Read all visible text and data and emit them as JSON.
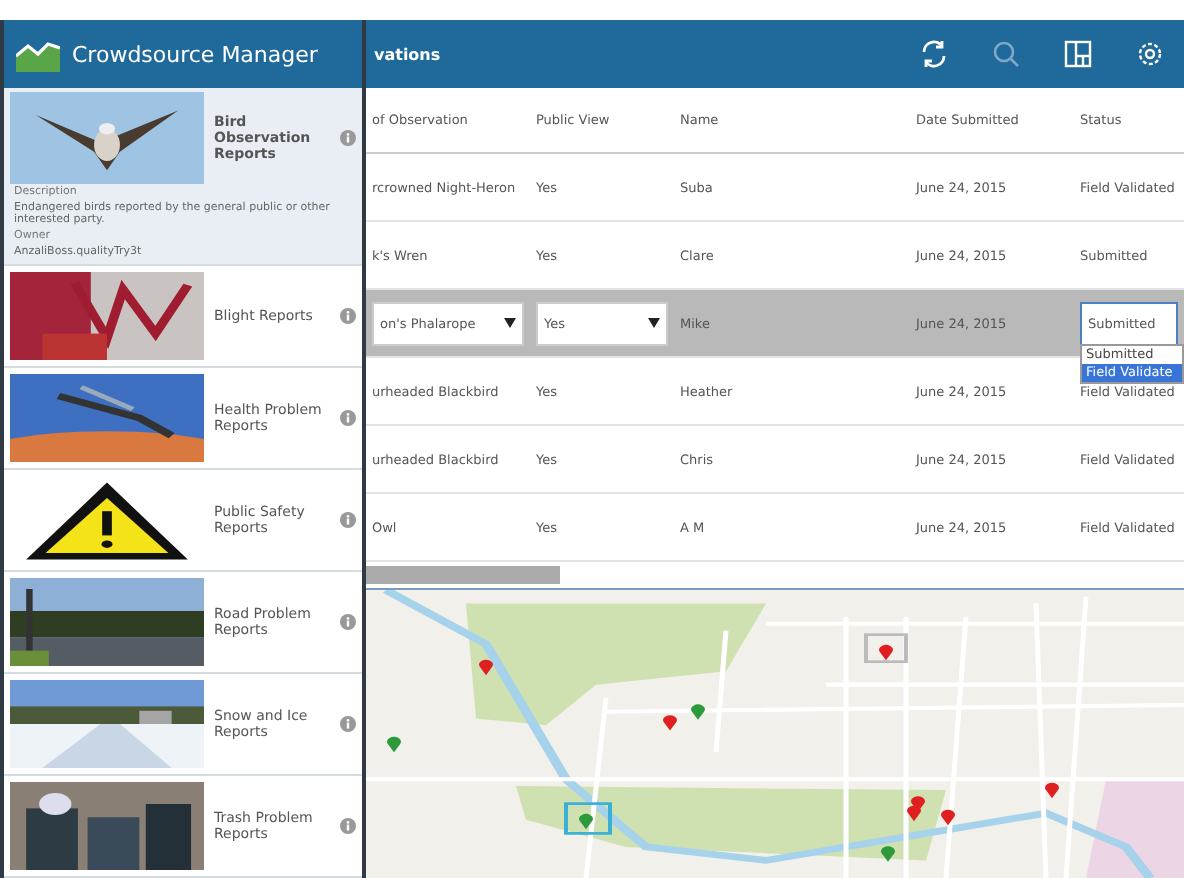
{
  "sidebar": {
    "title": "Crowdsource Manager",
    "reports": [
      {
        "title": "Bird Observation Reports",
        "selected": true,
        "details": [
          {
            "kind": "label",
            "text": "Description"
          },
          {
            "kind": "value",
            "text": "Endangered birds reported by the general public or other interested party."
          },
          {
            "kind": "label",
            "text": "Owner"
          },
          {
            "kind": "value",
            "text": "AnzaliBoss.qualityTry3t"
          }
        ]
      },
      {
        "title": "Blight Reports",
        "selected": false
      },
      {
        "title": "Health Problem Reports",
        "selected": false
      },
      {
        "title": "Public Safety Reports",
        "selected": false
      },
      {
        "title": "Road Problem Reports",
        "selected": false
      },
      {
        "title": "Snow and Ice Reports",
        "selected": false
      },
      {
        "title": "Trash Problem Reports",
        "selected": false
      }
    ]
  },
  "main": {
    "title": "vations",
    "table": {
      "columns": [
        "of Observation",
        "Public View",
        "Name",
        "Date Submitted",
        "Status"
      ],
      "rows": [
        {
          "cells": [
            "rcrowned Night-Heron",
            "Yes",
            "Suba",
            "June 24, 2015",
            "Field Validated"
          ],
          "selected": false
        },
        {
          "cells": [
            "k's Wren",
            "Yes",
            "Clare",
            "June 24, 2015",
            "Submitted"
          ],
          "selected": false
        },
        {
          "cells": [
            "on's Phalarope",
            "Yes",
            "Mike",
            "June 24, 2015",
            "Submitted"
          ],
          "selected": true,
          "status_options": [
            {
              "label": "Submitted",
              "selected": false
            },
            {
              "label": "Field Validate",
              "selected": true
            }
          ]
        },
        {
          "cells": [
            "urheaded Blackbird",
            "Yes",
            "Heather",
            "June 24, 2015",
            "Field Validated"
          ],
          "selected": false
        },
        {
          "cells": [
            "urheaded Blackbird",
            "Yes",
            "Chris",
            "June 24, 2015",
            "Field Validated"
          ],
          "selected": false
        },
        {
          "cells": [
            "Owl",
            "Yes",
            "A M",
            "June 24, 2015",
            "Field Validated"
          ],
          "selected": false
        }
      ]
    }
  }
}
